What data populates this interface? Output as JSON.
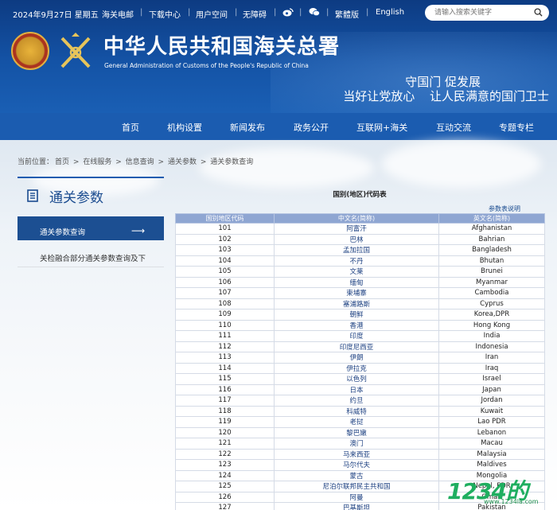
{
  "topbar": {
    "date": "2024年9月27日 星期五",
    "links": [
      "海关电邮",
      "下载中心",
      "用户空间",
      "无障碍"
    ],
    "traditional": "繁體版",
    "english": "English",
    "search_placeholder": "请输入搜索关键字"
  },
  "site": {
    "title": "中华人民共和国海关总署",
    "subtitle": "General Administration of Customs of the People's Republic of China",
    "slogan_line1": "守国门 促发展",
    "slogan_line2": "当好让党放心 让人民满意的国门卫士"
  },
  "nav": [
    "首页",
    "机构设置",
    "新闻发布",
    "政务公开",
    "互联网+海关",
    "互动交流",
    "专题专栏"
  ],
  "breadcrumb": {
    "prefix": "当前位置：",
    "items": [
      "首页",
      "在线服务",
      "信息查询",
      "通关参数",
      "通关参数查询"
    ],
    "separator": ">"
  },
  "sidebar": {
    "title": "通关参数",
    "items": [
      {
        "label": "通关参数查询",
        "active": true
      },
      {
        "label": "关检融合部分通关参数查询及下",
        "active": false
      }
    ]
  },
  "table": {
    "title": "国别(地区)代码表",
    "note_link": "参数表说明",
    "headers": [
      "国别地区代码",
      "中文名(简称)",
      "英文名(简称)"
    ],
    "rows": [
      [
        "101",
        "阿富汗",
        "Afghanistan"
      ],
      [
        "102",
        "巴林",
        "Bahrian"
      ],
      [
        "103",
        "孟加拉国",
        "Bangladesh"
      ],
      [
        "104",
        "不丹",
        "Bhutan"
      ],
      [
        "105",
        "文莱",
        "Brunei"
      ],
      [
        "106",
        "缅甸",
        "Myanmar"
      ],
      [
        "107",
        "柬埔寨",
        "Cambodia"
      ],
      [
        "108",
        "塞浦路斯",
        "Cyprus"
      ],
      [
        "109",
        "朝鲜",
        "Korea,DPR"
      ],
      [
        "110",
        "香港",
        "Hong Kong"
      ],
      [
        "111",
        "印度",
        "India"
      ],
      [
        "112",
        "印度尼西亚",
        "Indonesia"
      ],
      [
        "113",
        "伊朗",
        "Iran"
      ],
      [
        "114",
        "伊拉克",
        "Iraq"
      ],
      [
        "115",
        "以色列",
        "Israel"
      ],
      [
        "116",
        "日本",
        "Japan"
      ],
      [
        "117",
        "约旦",
        "Jordan"
      ],
      [
        "118",
        "科威特",
        "Kuwait"
      ],
      [
        "119",
        "老挝",
        "Lao PDR"
      ],
      [
        "120",
        "黎巴嫩",
        "Lebanon"
      ],
      [
        "121",
        "澳门",
        "Macau"
      ],
      [
        "122",
        "马来西亚",
        "Malaysia"
      ],
      [
        "123",
        "马尔代夫",
        "Maldives"
      ],
      [
        "124",
        "蒙古",
        "Mongolia"
      ],
      [
        "125",
        "尼泊尔联邦民主共和国",
        "Nepal, FDR"
      ],
      [
        "126",
        "阿曼",
        "Oman"
      ],
      [
        "127",
        "巴基斯坦",
        "Pakistan"
      ]
    ]
  },
  "watermark": {
    "text": "1234的",
    "url": "www.1234la.com"
  },
  "colors": {
    "header": "#1453a6",
    "nav": "#1b5cb0",
    "sidebar_active": "#1c4f92",
    "table_header": "#8fa6d2"
  },
  "icons": [
    "search-icon",
    "weibo-icon",
    "wechat-icon",
    "national-emblem",
    "customs-emblem",
    "document-icon",
    "arrow-right-icon"
  ]
}
